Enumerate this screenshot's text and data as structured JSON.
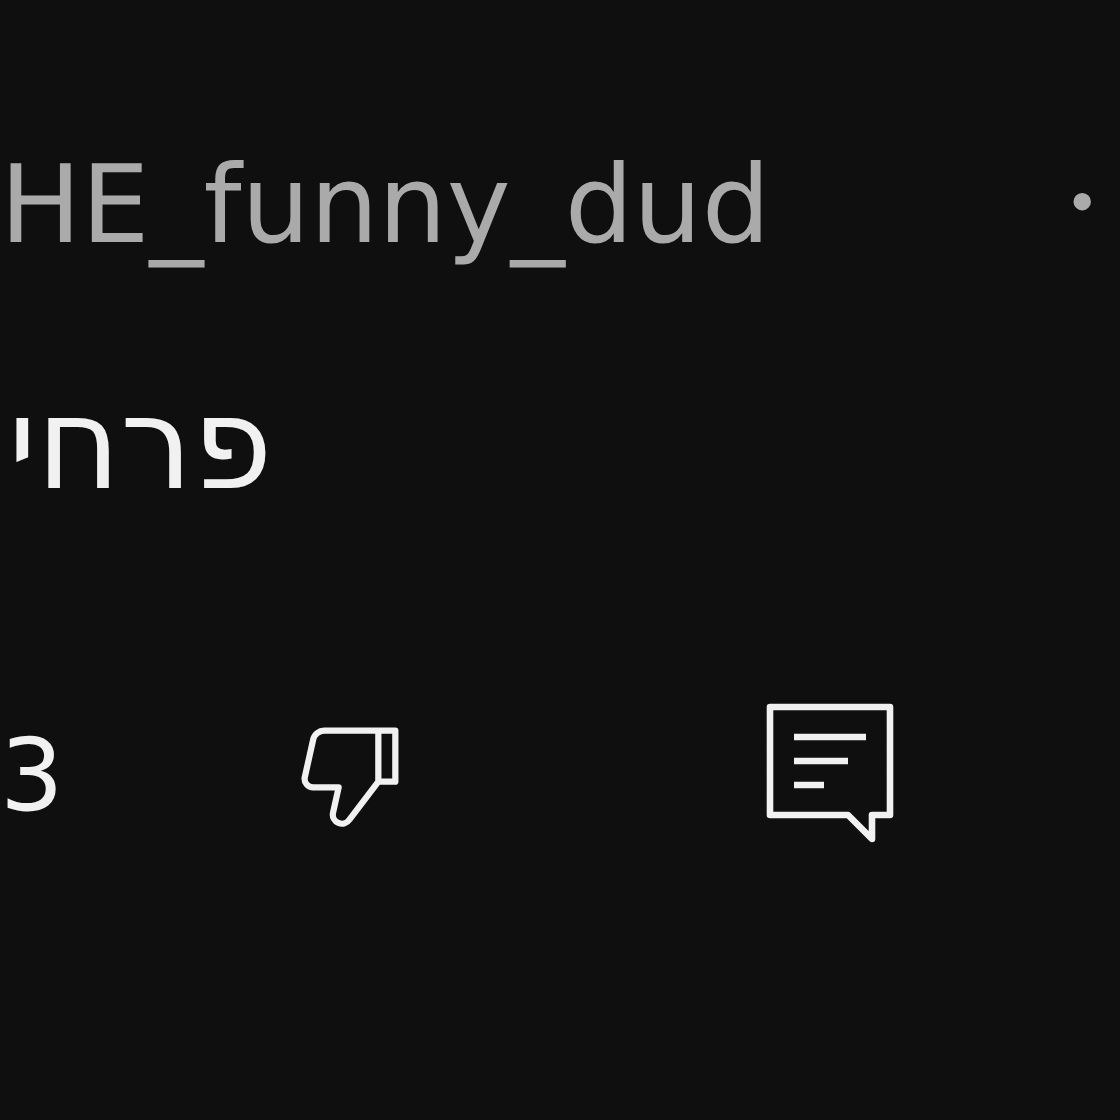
{
  "comment": {
    "author": "HE_funny_dud",
    "separator": "•",
    "text": "פרחי",
    "like_count": "3"
  }
}
